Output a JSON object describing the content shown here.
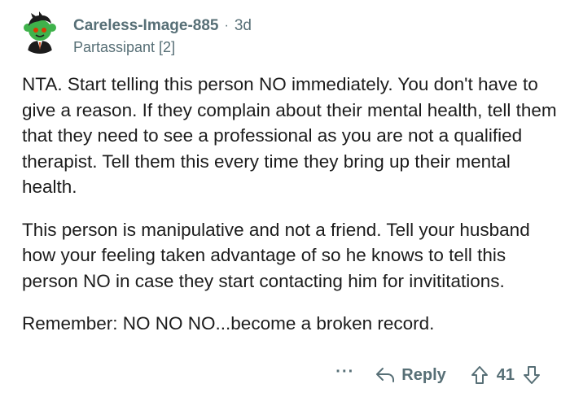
{
  "comment": {
    "author": "Careless-Image-885",
    "separator": "·",
    "age": "3d",
    "flair": "Partassipant [2]",
    "paragraphs": [
      "NTA.  Start telling this person NO immediately.  You don't have to give a reason.  If they complain about their mental health, tell them that they need to see a professional as you are not a qualified therapist.  Tell them this every time they bring up their mental health.",
      "This person is manipulative and not a friend.  Tell your husband how your feeling taken advantage of so he knows to tell this person NO in case they start contacting him for invititations.",
      "Remember:  NO  NO  NO...become a broken record."
    ],
    "actions": {
      "more_label": "···",
      "reply_label": "Reply",
      "vote_count": "41"
    }
  },
  "colors": {
    "meta_text": "#576f76",
    "body_text": "#1c1c1c",
    "avatar_green": "#3fb24b"
  },
  "icons": {
    "avatar": "snoo-avatar-icon",
    "reply": "reply-arrow-icon",
    "upvote": "upvote-arrow-icon",
    "downvote": "downvote-arrow-icon"
  }
}
